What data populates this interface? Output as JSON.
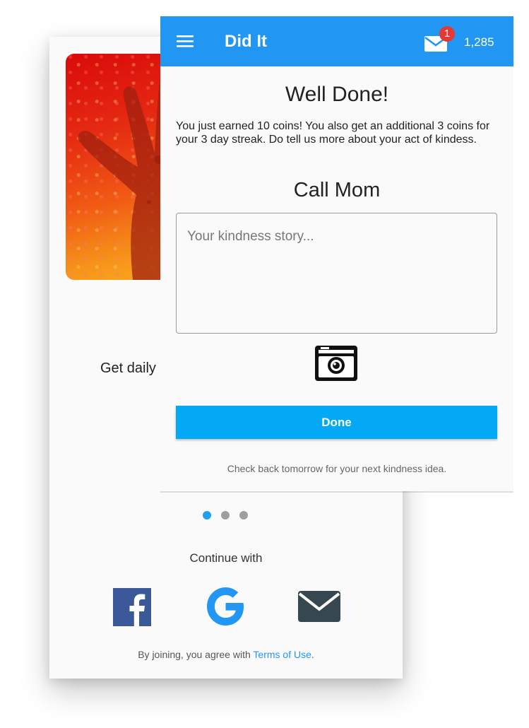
{
  "colors": {
    "app_bar": "#2196f3",
    "accent_button": "#03a9f4",
    "badge": "#e53935",
    "link": "#2196f3",
    "dot_active": "#1e9ff0",
    "dot_inactive": "#9e9e9e",
    "facebook": "#3b5998",
    "google": "#2196f3",
    "email": "#37474f"
  },
  "back_screen": {
    "hero_image_icon": "hand-artwork",
    "tagline_partial": "Get daily",
    "pager": {
      "total": 3,
      "active_index": 0
    },
    "continue_label": "Continue with",
    "social": [
      {
        "name": "facebook",
        "icon": "facebook-icon"
      },
      {
        "name": "google",
        "icon": "google-icon"
      },
      {
        "name": "email",
        "icon": "envelope-icon"
      }
    ],
    "legal": {
      "prefix": "By joining, you agree with ",
      "link": "Terms of Use",
      "suffix": "."
    }
  },
  "front_screen": {
    "app_bar": {
      "menu_icon": "hamburger-menu-icon",
      "title": "Did It",
      "mail_icon": "envelope-icon",
      "notification_count": "1",
      "coins": "1,285"
    },
    "heading": "Well Done!",
    "message": "You just earned 10 coins! You also get an additional 3 coins for your 3 day streak. Do tell us more about your act of kindess.",
    "deed_title": "Call Mom",
    "story": {
      "value": "",
      "placeholder": "Your kindness story..."
    },
    "camera_icon": "camera-icon",
    "done_label": "Done",
    "footer_note": "Check back tomorrow for your next kindness idea."
  }
}
